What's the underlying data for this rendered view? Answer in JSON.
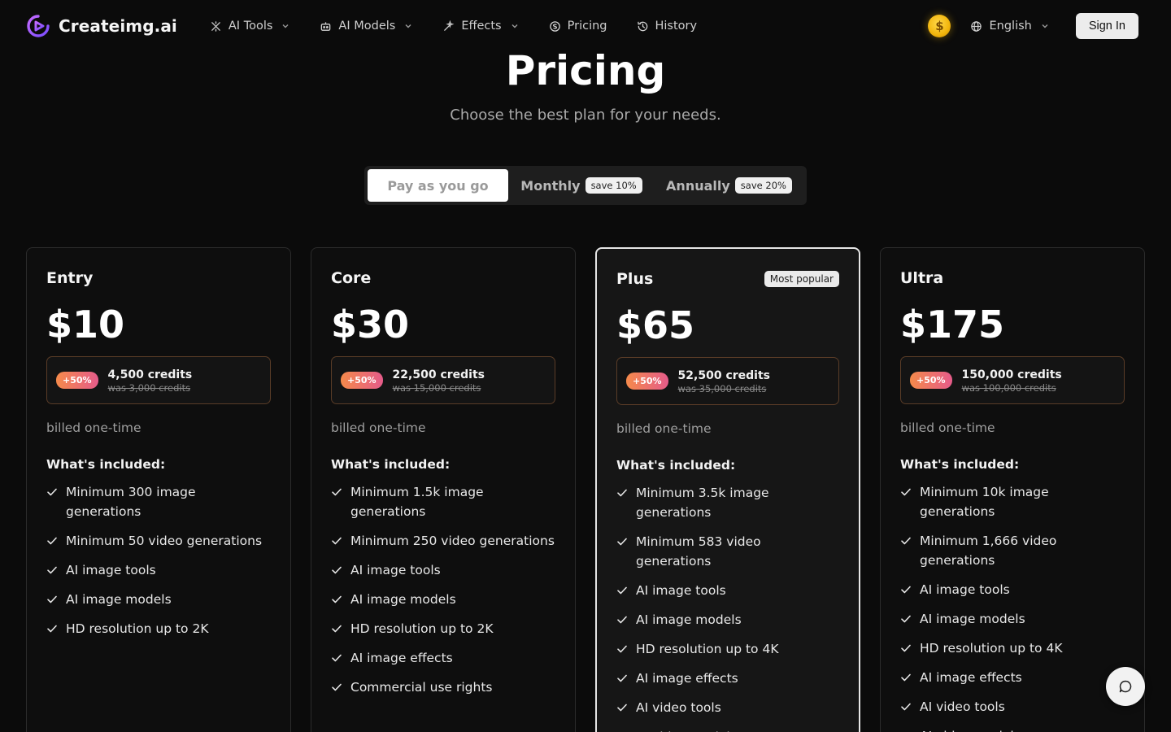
{
  "nav": {
    "brand": "Createimg.ai",
    "links": [
      {
        "label": "AI Tools",
        "icon": "sparkle-tools-icon",
        "dropdown": true
      },
      {
        "label": "AI Models",
        "icon": "robot-icon",
        "dropdown": true
      },
      {
        "label": "Effects",
        "icon": "effects-icon",
        "dropdown": true
      },
      {
        "label": "Pricing",
        "icon": "coin-dollar-icon",
        "dropdown": false
      },
      {
        "label": "History",
        "icon": "history-icon",
        "dropdown": false
      }
    ],
    "coin_symbol": "$",
    "language": "English",
    "sign_in": "Sign In"
  },
  "hero": {
    "title": "Pricing",
    "subtitle": "Choose the best plan for your needs."
  },
  "billing_toggle": {
    "options": [
      {
        "label": "Pay as you go",
        "badge": "",
        "active": true
      },
      {
        "label": "Monthly",
        "badge": "save 10%",
        "active": false
      },
      {
        "label": "Annually",
        "badge": "save 20%",
        "active": false
      }
    ]
  },
  "plans": [
    {
      "name": "Entry",
      "price": "$10",
      "badge": "",
      "bonus": "+50%",
      "credits": "4,500 credits",
      "was": "was 3,000 credits",
      "billed": "billed one-time",
      "included_label": "What's included:",
      "features": [
        "Minimum 300 image generations",
        "Minimum 50 video generations",
        "AI image tools",
        "AI image models",
        "HD resolution up to 2K"
      ]
    },
    {
      "name": "Core",
      "price": "$30",
      "badge": "",
      "bonus": "+50%",
      "credits": "22,500 credits",
      "was": "was 15,000 credits",
      "billed": "billed one-time",
      "included_label": "What's included:",
      "features": [
        "Minimum 1.5k image generations",
        "Minimum 250 video generations",
        "AI image tools",
        "AI image models",
        "HD resolution up to 2K",
        "AI image effects",
        "Commercial use rights"
      ]
    },
    {
      "name": "Plus",
      "price": "$65",
      "badge": "Most popular",
      "bonus": "+50%",
      "credits": "52,500 credits",
      "was": "was 35,000 credits",
      "billed": "billed one-time",
      "included_label": "What's included:",
      "features": [
        "Minimum 3.5k image generations",
        "Minimum 583 video generations",
        "AI image tools",
        "AI image models",
        "HD resolution up to 4K",
        "AI image effects",
        "AI video tools",
        "AI video models"
      ]
    },
    {
      "name": "Ultra",
      "price": "$175",
      "badge": "",
      "bonus": "+50%",
      "credits": "150,000 credits",
      "was": "was 100,000 credits",
      "billed": "billed one-time",
      "included_label": "What's included:",
      "features": [
        "Minimum 10k image generations",
        "Minimum 1,666 video generations",
        "AI image tools",
        "AI image models",
        "HD resolution up to 4K",
        "AI image effects",
        "AI video tools",
        "AI video models"
      ]
    }
  ],
  "chat": {
    "icon": "chat-bubble-icon"
  }
}
